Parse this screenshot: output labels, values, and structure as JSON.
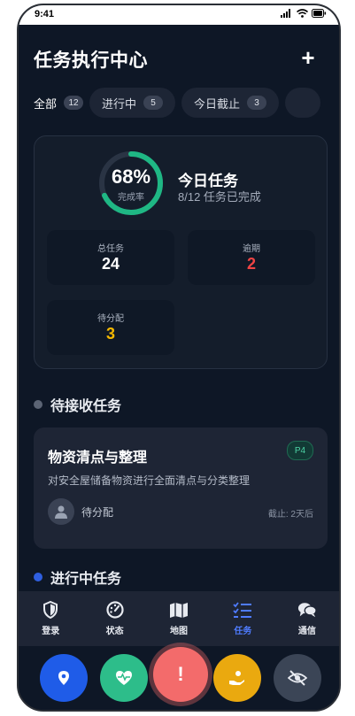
{
  "status_bar": {
    "time": "9:41",
    "icons": [
      "signal-icon",
      "wifi-icon",
      "battery-icon"
    ]
  },
  "header": {
    "title": "任务执行中心",
    "add_icon": "plus-icon",
    "add_symbol": "+"
  },
  "tabs": [
    {
      "label": "全部",
      "count": "12",
      "active": true
    },
    {
      "label": "进行中",
      "count": "5",
      "active": false
    },
    {
      "label": "今日截止",
      "count": "3",
      "active": false
    },
    {
      "label": "",
      "count": "",
      "active": false
    }
  ],
  "summary": {
    "completion_percent": 68,
    "percent_text": "68%",
    "completion_label": "完成率",
    "today_title": "今日任务",
    "today_subtitle": "8/12 任务已完成",
    "stats": [
      {
        "label": "总任务",
        "value": "24",
        "color": "#ffffff"
      },
      {
        "label": "逾期",
        "value": "2",
        "color": "#ef4444"
      },
      {
        "label": "待分配",
        "value": "3",
        "color": "#f5b800"
      }
    ]
  },
  "sections": {
    "pending": {
      "title": "待接收任务",
      "dot_color": "#5b6474"
    },
    "in_progress": {
      "title": "进行中任务",
      "dot_color": "#2f5fe0"
    }
  },
  "task": {
    "title": "物资清点与整理",
    "priority": "P4",
    "description": "对安全屋储备物资进行全面清点与分类整理",
    "assignee": "待分配",
    "deadline": "截止: 2天后"
  },
  "bottom_nav": [
    {
      "label": "登录",
      "icon": "shield-icon",
      "active": false
    },
    {
      "label": "状态",
      "icon": "gauge-icon",
      "active": false
    },
    {
      "label": "地图",
      "icon": "map-icon",
      "active": false
    },
    {
      "label": "任务",
      "icon": "task-list-icon",
      "active": true
    },
    {
      "label": "通信",
      "icon": "chat-icon",
      "active": false
    }
  ],
  "fab_buttons": [
    {
      "icon": "location-pin-icon",
      "color": "#1f5ce8"
    },
    {
      "icon": "heart-pulse-icon",
      "color": "#2dbd8a"
    },
    {
      "icon": "alert-icon",
      "symbol": "!",
      "color": "#f36b6b"
    },
    {
      "icon": "hand-person-icon",
      "color": "#eaa90f"
    },
    {
      "icon": "eye-off-icon",
      "color": "#3b4556"
    }
  ]
}
